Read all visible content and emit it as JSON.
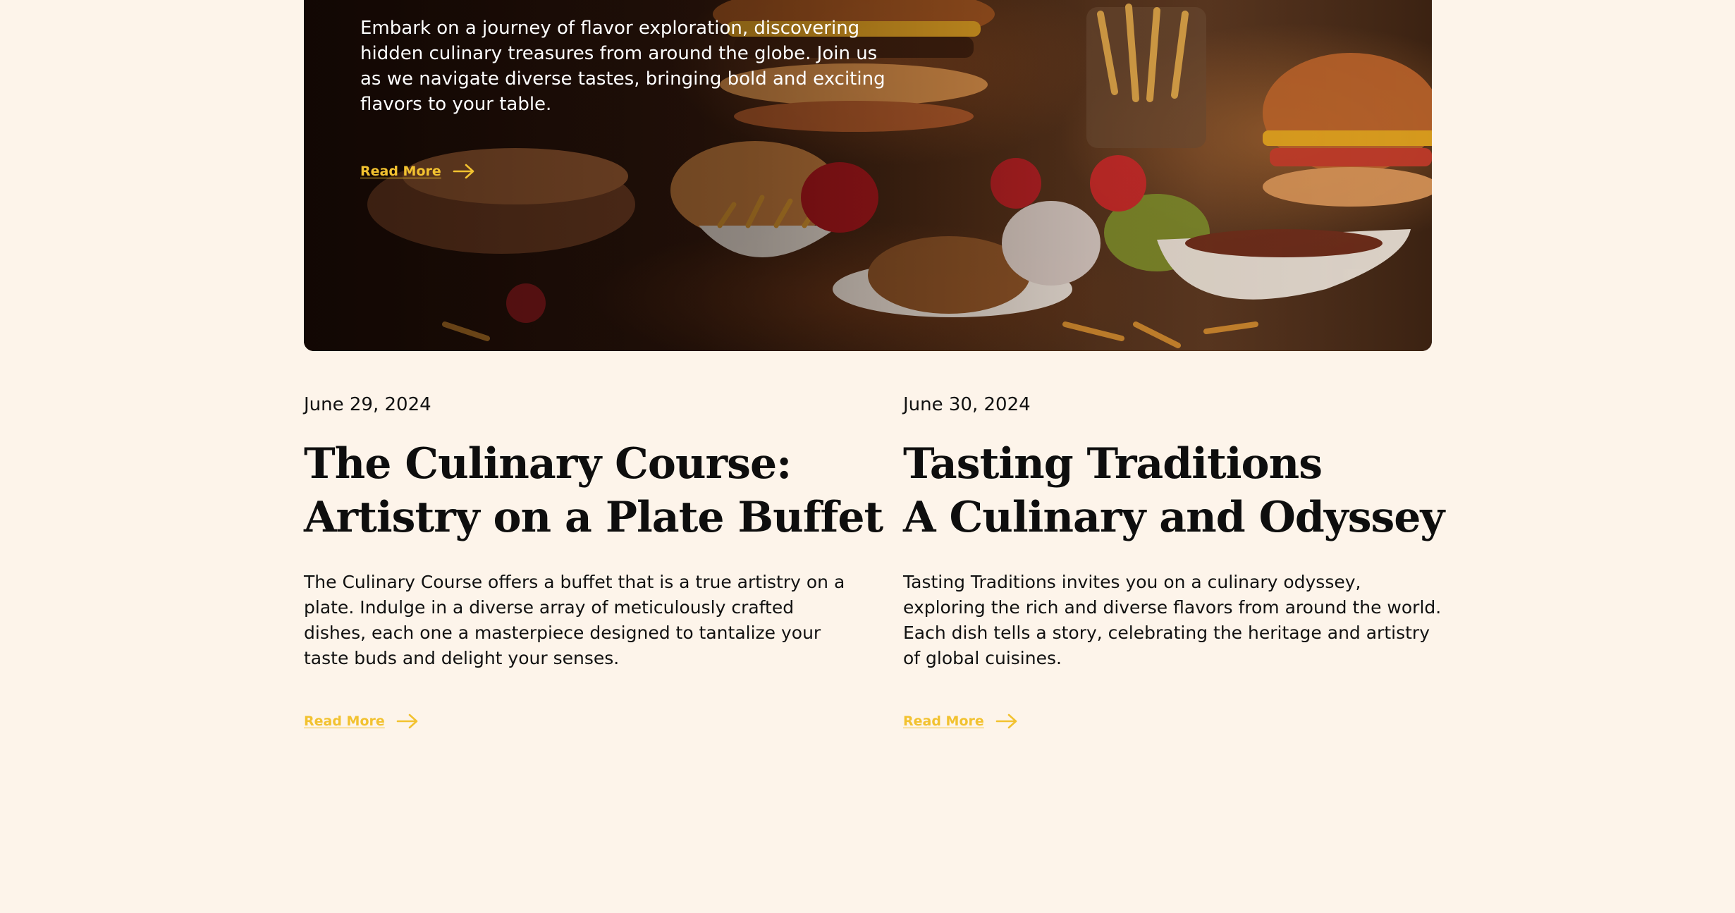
{
  "hero": {
    "text": "Embark on a journey of flavor exploration, discovering hidden culinary treasures from around the globe. Join us as we navigate diverse tastes, bringing bold and exciting flavors to your table.",
    "read_more": "Read More"
  },
  "posts": [
    {
      "date": "June 29, 2024",
      "title_line1": "The Culinary Course:",
      "title_line2": "Artistry on a Plate Buffet",
      "excerpt": "The Culinary Course offers a buffet that is a true artistry on a plate. Indulge in a diverse array of meticulously crafted dishes, each one a masterpiece designed to tantalize your taste buds and delight your senses.",
      "read_more": "Read More"
    },
    {
      "date": "June 30, 2024",
      "title_line1": "Tasting Traditions",
      "title_line2": "A Culinary and Odyssey",
      "excerpt": "Tasting Traditions invites you on a culinary odyssey, exploring the rich and diverse flavors from around the world. Each dish tells a story, celebrating the heritage and artistry of global cuisines.",
      "read_more": "Read More"
    }
  ],
  "colors": {
    "page_background": "#fdf4ea",
    "link_accent": "#f2c230",
    "heading": "#0e0e0e",
    "hero_text": "#ffffff"
  },
  "icons": {
    "read_more_arrow": "arrow-right-icon",
    "hero_image": "food-spread-photo"
  }
}
